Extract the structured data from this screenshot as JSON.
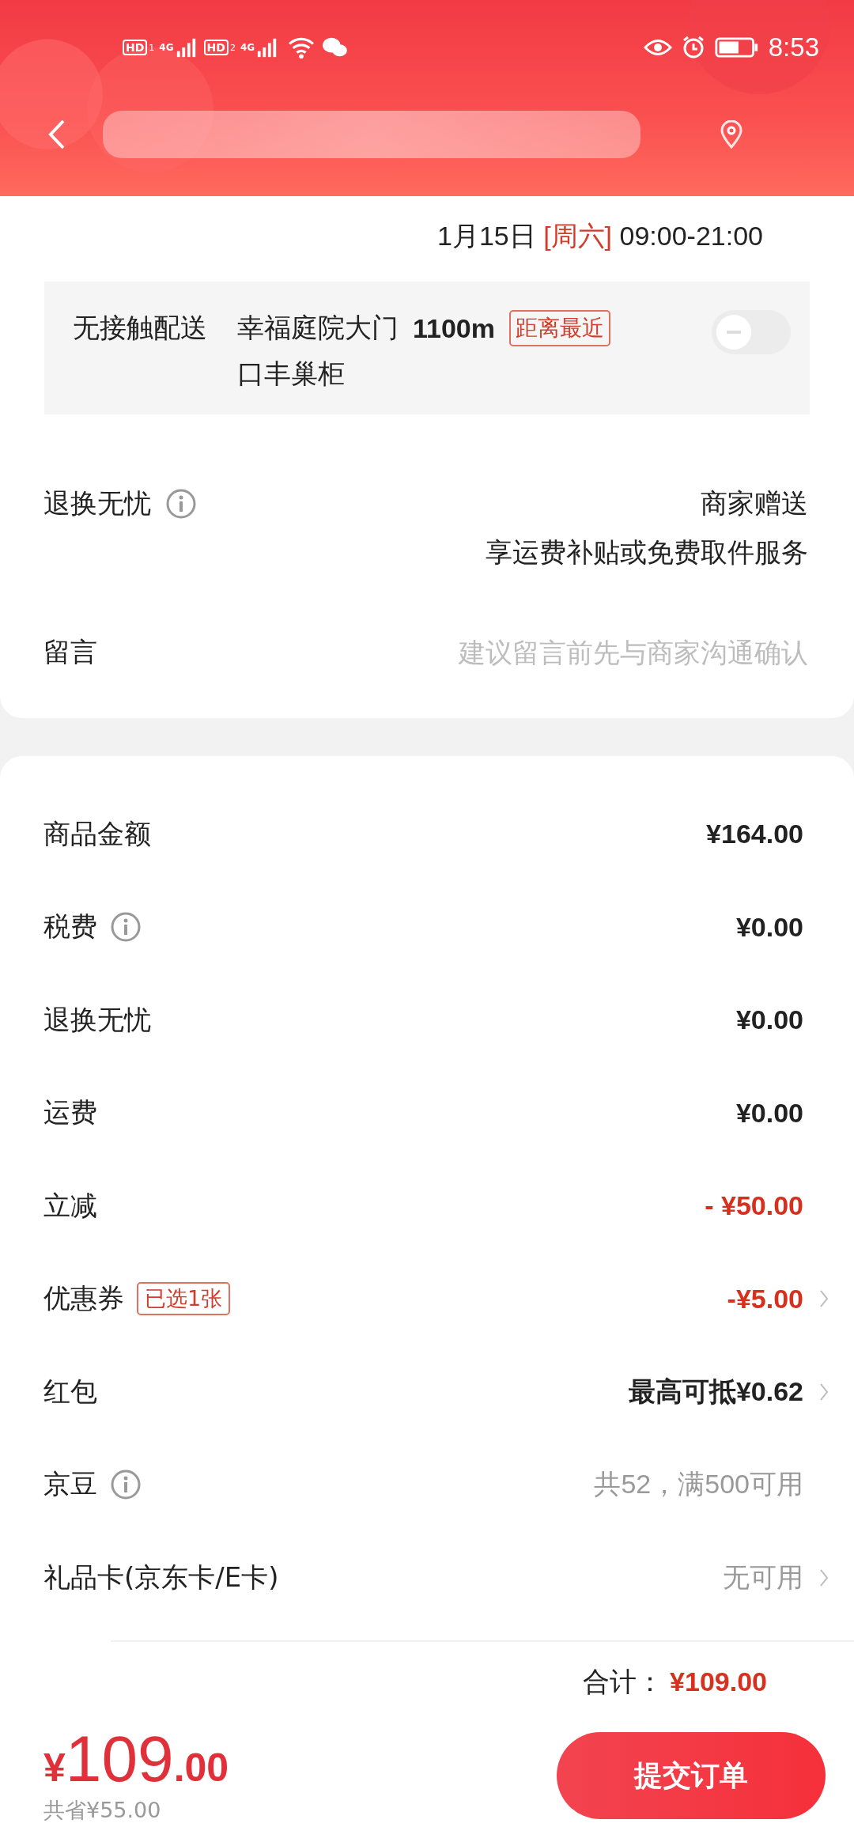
{
  "status_bar": {
    "sims": [
      {
        "hd": "HD",
        "slot": "1",
        "network": "4G"
      },
      {
        "hd": "HD",
        "slot": "2",
        "network": "4G"
      }
    ],
    "time": "8:53"
  },
  "delivery": {
    "date": "1月15日",
    "weekday": "[周六]",
    "hours": "09:00-21:00"
  },
  "contactless": {
    "label": "无接触配送",
    "place": "幸福庭院大门",
    "distance": "1100m",
    "tag": "距离最近",
    "place_line2": "口丰巢柜",
    "on": false
  },
  "return_service": {
    "label": "退换无忧",
    "value": "商家赠送",
    "note": "享运费补贴或免费取件服务"
  },
  "message": {
    "label": "留言",
    "placeholder": "建议留言前先与商家沟通确认"
  },
  "fees": [
    {
      "label": "商品金额",
      "value": "¥164.00",
      "kind": "amount",
      "info": false,
      "chevron": false
    },
    {
      "label": "税费",
      "value": "¥0.00",
      "kind": "amount",
      "info": true,
      "chevron": false
    },
    {
      "label": "退换无忧",
      "value": "¥0.00",
      "kind": "amount",
      "info": false,
      "chevron": false
    },
    {
      "label": "运费",
      "value": "¥0.00",
      "kind": "amount",
      "info": false,
      "chevron": false
    },
    {
      "label": "立减",
      "value": "- ¥50.00",
      "kind": "discount",
      "info": false,
      "chevron": false
    },
    {
      "label": "优惠券",
      "tag": "已选1张",
      "value": "-¥5.00",
      "kind": "discount",
      "info": false,
      "chevron": true
    },
    {
      "label": "红包",
      "value": "最高可抵¥0.62",
      "kind": "amount",
      "info": false,
      "chevron": true
    },
    {
      "label": "京豆",
      "value": "共52，满500可用",
      "kind": "hint",
      "info": true,
      "chevron": false
    },
    {
      "label": "礼品卡(京东卡/E卡)",
      "value": "无可用",
      "kind": "hint",
      "info": false,
      "chevron": true
    }
  ],
  "total": {
    "label": "合计：",
    "value": "¥109.00"
  },
  "footer": {
    "currency": "¥",
    "price_int": "109",
    "price_dec": ".00",
    "saved": "共省¥55.00",
    "submit": "提交订单"
  }
}
